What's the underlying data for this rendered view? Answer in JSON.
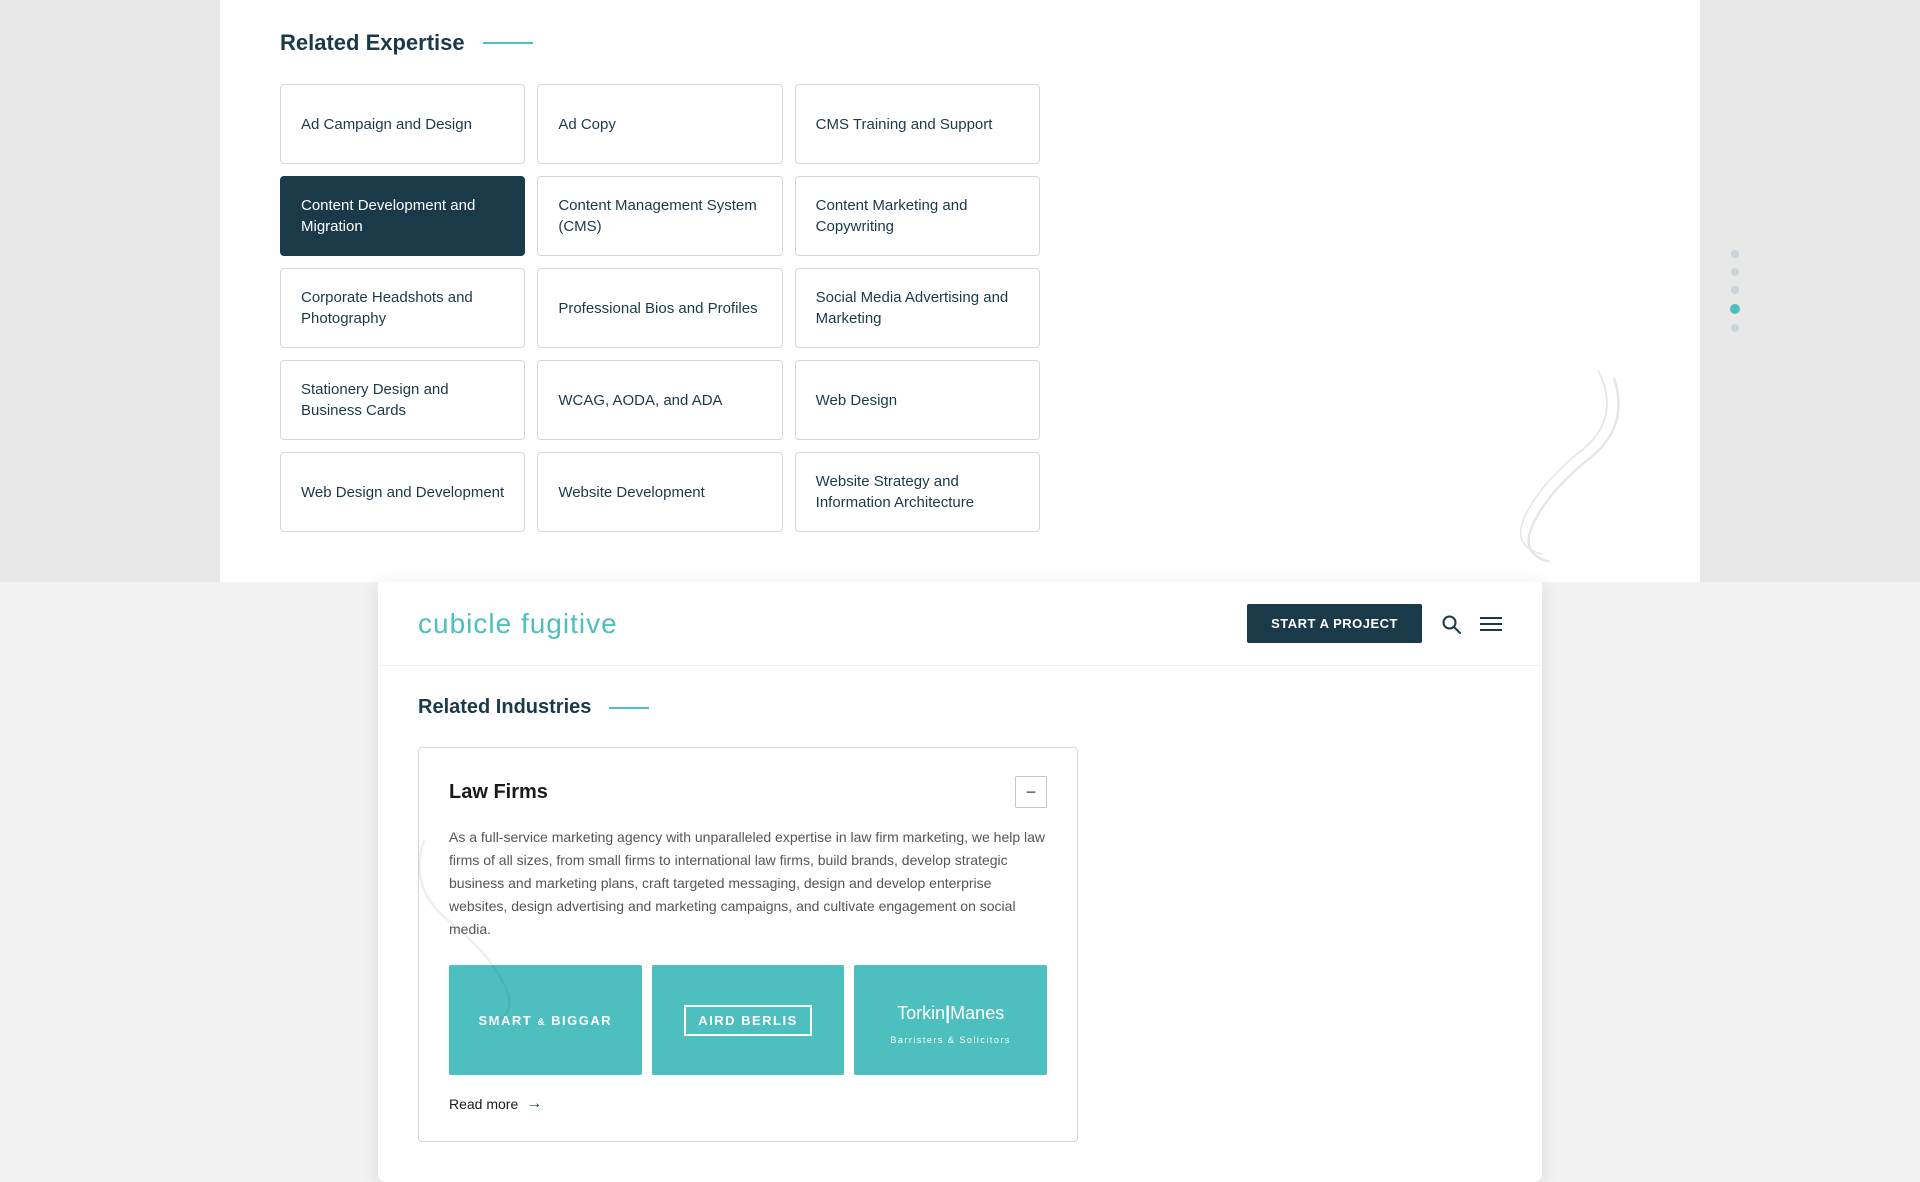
{
  "top": {
    "section_title": "Related Expertise",
    "cards": [
      {
        "id": "ad-campaign",
        "label": "Ad Campaign and Design",
        "active": false
      },
      {
        "id": "ad-copy",
        "label": "Ad Copy",
        "active": false
      },
      {
        "id": "cms-training",
        "label": "CMS Training and Support",
        "active": false
      },
      {
        "id": "content-dev",
        "label": "Content Development and Migration",
        "active": true
      },
      {
        "id": "content-mgmt",
        "label": "Content Management System (CMS)",
        "active": false
      },
      {
        "id": "content-mktg",
        "label": "Content Marketing and Copywriting",
        "active": false
      },
      {
        "id": "corp-headshots",
        "label": "Corporate Headshots and Photography",
        "active": false
      },
      {
        "id": "prof-bios",
        "label": "Professional Bios and Profiles",
        "active": false
      },
      {
        "id": "social-media",
        "label": "Social Media Advertising and Marketing",
        "active": false
      },
      {
        "id": "stationery",
        "label": "Stationery Design and Business Cards",
        "active": false
      },
      {
        "id": "wcag",
        "label": "WCAG, AODA, and ADA",
        "active": false
      },
      {
        "id": "web-design",
        "label": "Web Design",
        "active": false
      },
      {
        "id": "web-dev",
        "label": "Web Design and Development",
        "active": false
      },
      {
        "id": "website-dev",
        "label": "Website Development",
        "active": false
      },
      {
        "id": "website-strategy",
        "label": "Website Strategy and Information Architecture",
        "active": false
      }
    ],
    "scroll_dots": [
      {
        "active": false
      },
      {
        "active": false
      },
      {
        "active": false
      },
      {
        "active": true
      },
      {
        "active": false
      }
    ]
  },
  "bottom": {
    "logo": "cubicle fugitive",
    "nav": {
      "start_project": "START A PROJECT"
    },
    "section_title": "Related Industries",
    "accordion": {
      "title": "Law Firms",
      "toggle_symbol": "−",
      "body": "As a full-service marketing agency with unparalleled expertise in law firm marketing, we help law firms of all sizes, from small firms to international law firms, build brands, develop strategic business and marketing plans, craft targeted messaging, design and develop enterprise websites, design advertising and marketing campaigns, and cultivate engagement on social media.",
      "logos": [
        {
          "id": "smart-biggar",
          "text": "SMART & BIGGAR",
          "style": "plain"
        },
        {
          "id": "aird-berlis",
          "text": "AIRD BERLIS",
          "style": "bordered"
        },
        {
          "id": "torkin-manes",
          "text": "Torkin|Manes",
          "sub": "Barristers & Solicitors",
          "style": "serif"
        }
      ],
      "read_more": "Read more"
    },
    "scroll_dots": [
      {
        "active": false
      },
      {
        "active": false
      },
      {
        "active": false
      },
      {
        "active": false
      },
      {
        "active": true
      }
    ]
  }
}
